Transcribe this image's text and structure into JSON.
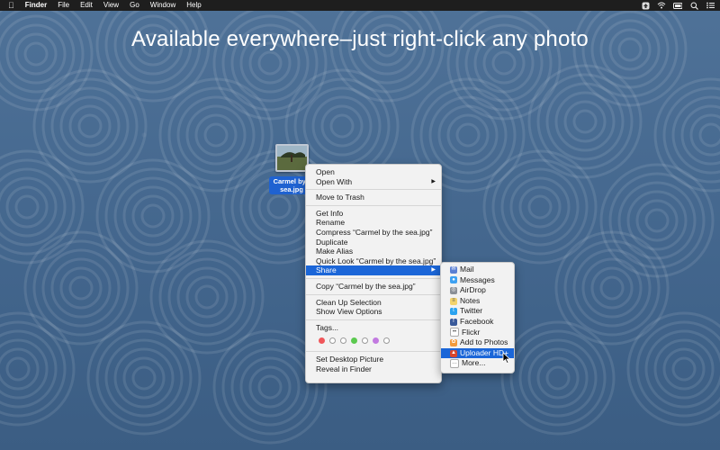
{
  "menubar": {
    "app": "Finder",
    "items": [
      "File",
      "Edit",
      "View",
      "Go",
      "Window",
      "Help"
    ]
  },
  "headline": "Available everywhere–just right-click any photo",
  "file": {
    "name_line1": "Carmel by t",
    "name_line2": "sea.jpg"
  },
  "context_menu": {
    "open": "Open",
    "open_with": "Open With",
    "move_to_trash": "Move to Trash",
    "get_info": "Get Info",
    "rename": "Rename",
    "compress": "Compress “Carmel by the sea.jpg”",
    "duplicate": "Duplicate",
    "make_alias": "Make Alias",
    "quick_look": "Quick Look “Carmel by the sea.jpg”",
    "share": "Share",
    "copy": "Copy “Carmel by the sea.jpg”",
    "clean_up": "Clean Up Selection",
    "view_options": "Show View Options",
    "tags": "Tags...",
    "tag_colors": [
      "#f0565a",
      "#ffffff",
      "#ffffff",
      "#5bc94f",
      "#ffffff",
      "#c27ae0",
      "#ffffff"
    ],
    "set_desktop": "Set Desktop Picture",
    "reveal": "Reveal in Finder"
  },
  "share_menu": [
    {
      "label": "Mail",
      "icon": "mail-icon",
      "color": "#5a7fd3"
    },
    {
      "label": "Messages",
      "icon": "messages-icon",
      "color": "#3da1f2"
    },
    {
      "label": "AirDrop",
      "icon": "airdrop-icon",
      "color": "#8a8f96"
    },
    {
      "label": "Notes",
      "icon": "notes-icon",
      "color": "#f3d36b"
    },
    {
      "label": "Twitter",
      "icon": "twitter-icon",
      "color": "#2aa3f0"
    },
    {
      "label": "Facebook",
      "icon": "facebook-icon",
      "color": "#3a5a9a"
    },
    {
      "label": "Flickr",
      "icon": "flickr-icon",
      "color": "#ffffff"
    },
    {
      "label": "Add to Photos",
      "icon": "photos-icon",
      "color": "#f39a3c"
    },
    {
      "label": "Uploader HD+",
      "icon": "uploader-icon",
      "color": "#d8462e"
    },
    {
      "label": "More...",
      "icon": "more-icon",
      "color": "#ffffff"
    }
  ]
}
